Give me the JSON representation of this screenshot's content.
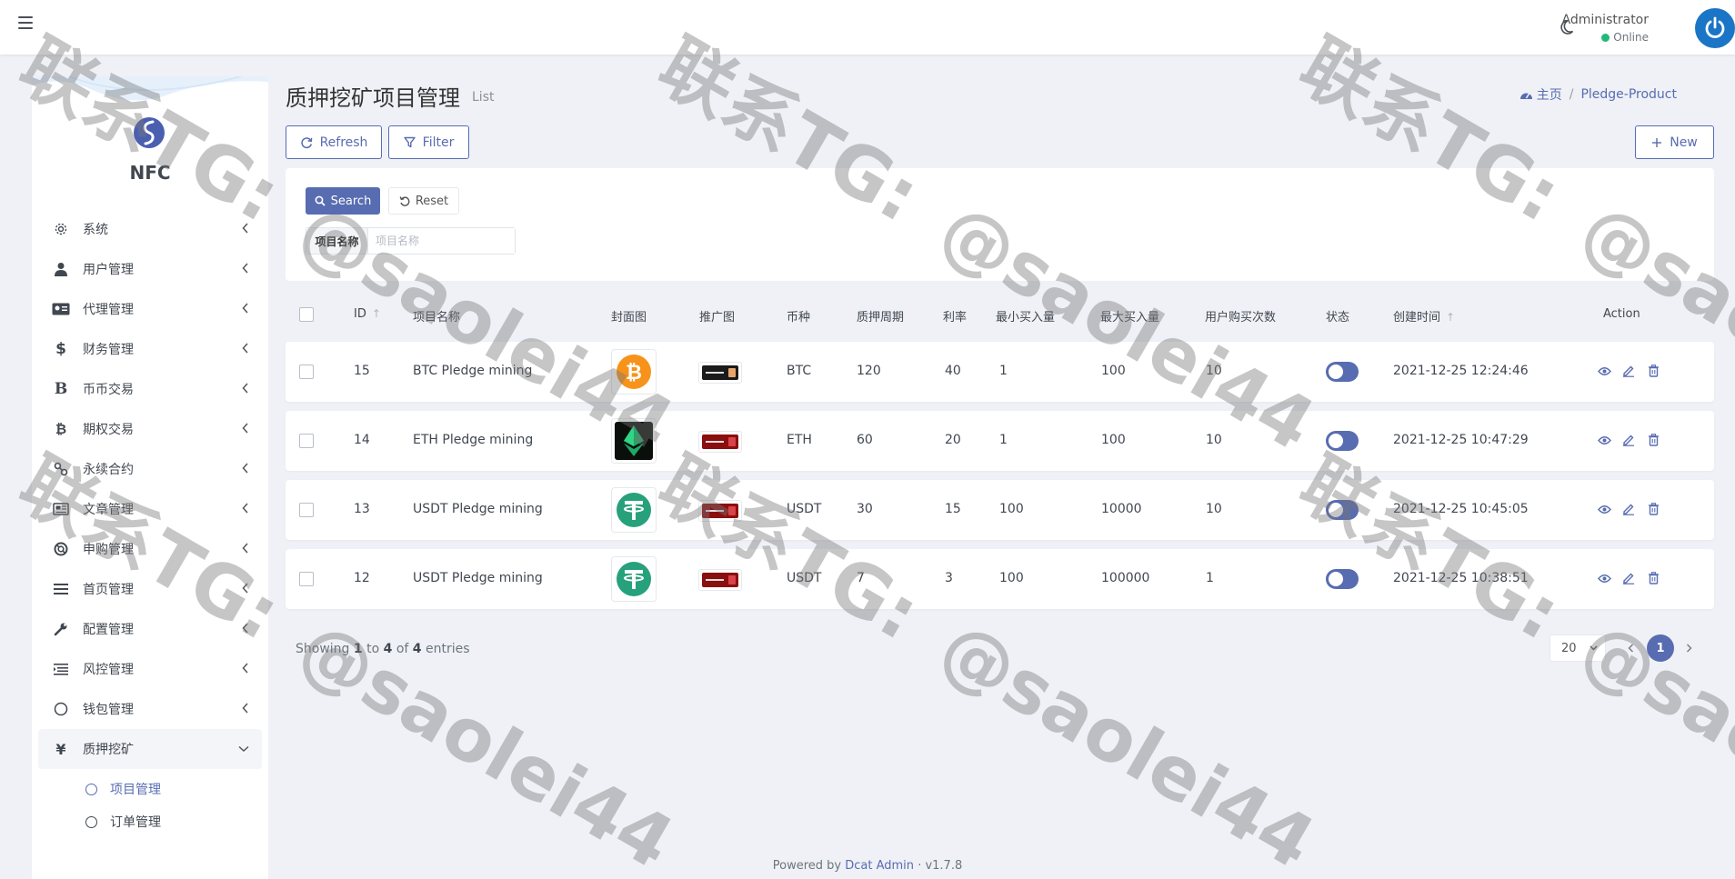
{
  "header": {
    "user_name": "Administrator",
    "user_status": "Online"
  },
  "sidebar": {
    "brand": "NFC",
    "menu": [
      {
        "label": "系统",
        "icon": "gear-icon"
      },
      {
        "label": "用户管理",
        "icon": "user-icon"
      },
      {
        "label": "代理管理",
        "icon": "id-card-icon"
      },
      {
        "label": "财务管理",
        "icon": "dollar-icon"
      },
      {
        "label": "币币交易",
        "icon": "b-icon"
      },
      {
        "label": "期权交易",
        "icon": "bitcoin-icon"
      },
      {
        "label": "永续合约",
        "icon": "link-icon"
      },
      {
        "label": "文章管理",
        "icon": "newspaper-icon"
      },
      {
        "label": "申购管理",
        "icon": "lifebuoy-icon"
      },
      {
        "label": "首页管理",
        "icon": "list-icon"
      },
      {
        "label": "配置管理",
        "icon": "wrench-icon"
      },
      {
        "label": "风控管理",
        "icon": "indent-list-icon"
      },
      {
        "label": "钱包管理",
        "icon": "circle-icon"
      },
      {
        "label": "质押挖矿",
        "icon": "yen-icon"
      }
    ],
    "submenu": [
      {
        "label": "项目管理"
      },
      {
        "label": "订单管理"
      }
    ]
  },
  "page": {
    "title": "质押挖矿项目管理",
    "subtitle": "List"
  },
  "breadcrumb": {
    "home": "主页",
    "current": "Pledge-Product"
  },
  "toolbar": {
    "refresh": "Refresh",
    "filter": "Filter",
    "new": "New"
  },
  "filter": {
    "search": "Search",
    "reset": "Reset",
    "label": "项目名称",
    "placeholder": "项目名称"
  },
  "table": {
    "headers": {
      "id": "ID",
      "name": "项目名称",
      "cover": "封面图",
      "promo": "推广图",
      "coin": "币种",
      "period": "质押周期",
      "rate": "利率",
      "min": "最小买入量",
      "max": "最大买入量",
      "times": "用户购买次数",
      "status": "状态",
      "created": "创建时间",
      "action": "Action"
    },
    "rows": [
      {
        "id": "15",
        "name": "BTC Pledge mining",
        "coin": "BTC",
        "period": "120",
        "rate": "40",
        "min": "1",
        "max": "100",
        "times": "10",
        "created": "2021-12-25 12:24:46",
        "cover_icon": "bitcoin-logo-icon"
      },
      {
        "id": "14",
        "name": "ETH Pledge mining",
        "coin": "ETH",
        "period": "60",
        "rate": "20",
        "min": "1",
        "max": "100",
        "times": "10",
        "created": "2021-12-25 10:47:29",
        "cover_icon": "ethereum-logo-icon"
      },
      {
        "id": "13",
        "name": "USDT Pledge mining",
        "coin": "USDT",
        "period": "30",
        "rate": "15",
        "min": "100",
        "max": "10000",
        "times": "10",
        "created": "2021-12-25 10:45:05",
        "cover_icon": "tether-logo-icon"
      },
      {
        "id": "12",
        "name": "USDT Pledge mining",
        "coin": "USDT",
        "period": "7",
        "rate": "3",
        "min": "100",
        "max": "100000",
        "times": "1",
        "created": "2021-12-25 10:38:51",
        "cover_icon": "tether-logo-icon"
      }
    ]
  },
  "pagination": {
    "showing": "Showing",
    "from": "1",
    "to_word": "to",
    "to": "4",
    "of_word": "of",
    "total": "4",
    "entries": "entries",
    "per_page": "20",
    "current": "1"
  },
  "footer": {
    "powered": "Powered by",
    "brand": "Dcat Admin",
    "version": "v1.7.8"
  },
  "watermark": {
    "line1": "联系TG:",
    "line2": "@saolei44"
  },
  "colors": {
    "primary": "#586cb1",
    "online": "#21b978",
    "background": "#eff1f6"
  }
}
